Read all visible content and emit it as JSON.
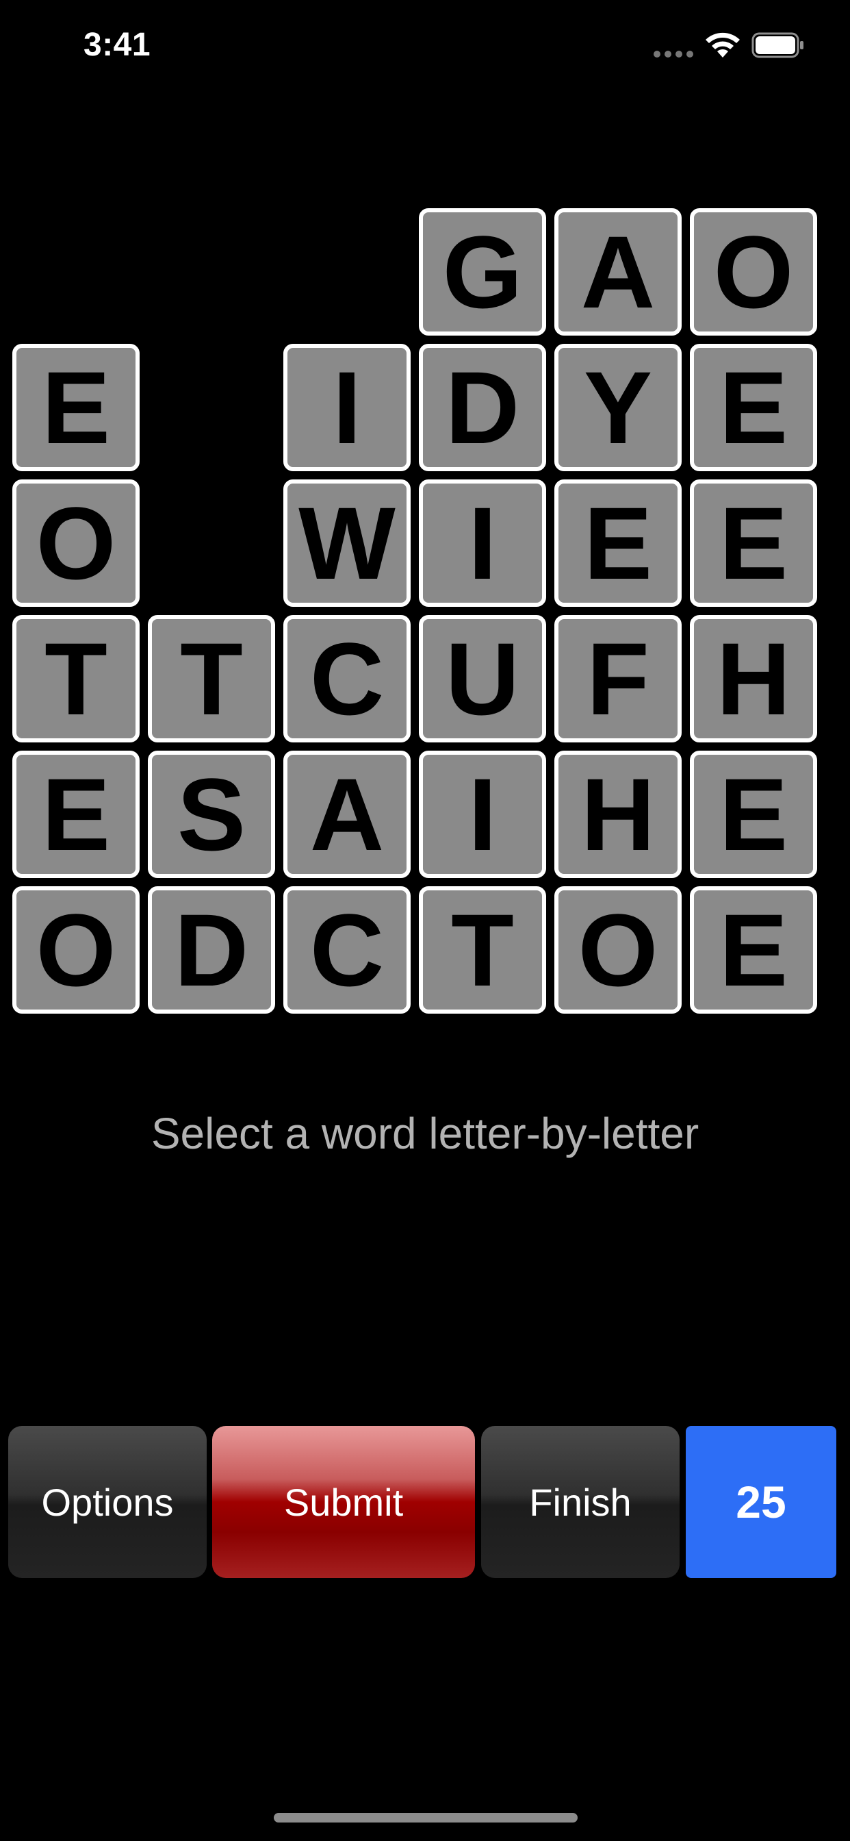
{
  "status_bar": {
    "time": "3:41",
    "signal_icon": "cellular-signal-icon",
    "wifi_icon": "wifi-icon",
    "battery_icon": "battery-icon"
  },
  "board": {
    "rows": [
      [
        null,
        null,
        null,
        "G",
        "A",
        "O"
      ],
      [
        "E",
        null,
        "I",
        "D",
        "Y",
        "E"
      ],
      [
        "O",
        null,
        "W",
        "I",
        "E",
        "E"
      ],
      [
        "T",
        "T",
        "C",
        "U",
        "F",
        "H"
      ],
      [
        "E",
        "S",
        "A",
        "I",
        "H",
        "E"
      ],
      [
        "O",
        "D",
        "C",
        "T",
        "O",
        "E"
      ]
    ],
    "tile_color": "#8a8a8a",
    "tile_border_color": "#ffffff"
  },
  "prompt": "Select a word letter-by-letter",
  "buttons": {
    "options": "Options",
    "submit": "Submit",
    "finish": "Finish"
  },
  "score": "25",
  "colors": {
    "background": "#000000",
    "submit_accent": "#a00000",
    "score_accent": "#2d6ef6"
  }
}
